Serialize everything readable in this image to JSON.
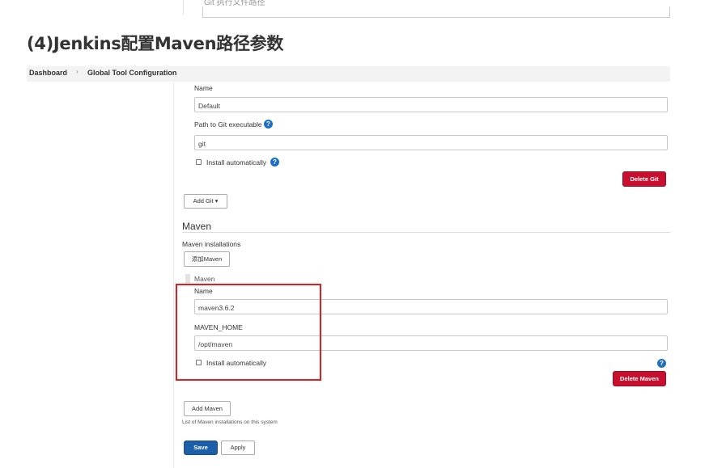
{
  "article": {
    "heading": "(4)Jenkins配置Maven路径参数"
  },
  "top_fragment": {
    "label": "Git 执行文件路径"
  },
  "breadcrumb": {
    "items": [
      "Dashboard",
      "Global Tool Configuration"
    ],
    "separator": "›"
  },
  "git": {
    "name_label": "Name",
    "name_value": "Default",
    "path_label": "Path to Git executable",
    "path_value": "git",
    "install_label": "Install automatically",
    "install_checked": false,
    "delete_label": "Delete Git",
    "add_label": "Add Git ▾"
  },
  "maven": {
    "section_title": "Maven",
    "installations_label": "Maven installations",
    "add_cn_label": "添加Maven",
    "item_header": "Maven",
    "name_label": "Name",
    "name_value": "maven3.6.2",
    "home_label": "MAVEN_HOME",
    "home_value": "/opt/maven",
    "install_label": "Install automatically",
    "install_checked": false,
    "delete_label": "Delete Maven",
    "add_label": "Add Maven",
    "list_note": "List of Maven installations on this system"
  },
  "actions": {
    "save_label": "Save",
    "apply_label": "Apply"
  },
  "icons": {
    "help": "?",
    "help_icon_name": "help-circle-icon"
  },
  "colors": {
    "danger": "#c8102e",
    "primary": "#1c5fa8",
    "help": "#1f6ec6",
    "highlight": "#e02020"
  }
}
